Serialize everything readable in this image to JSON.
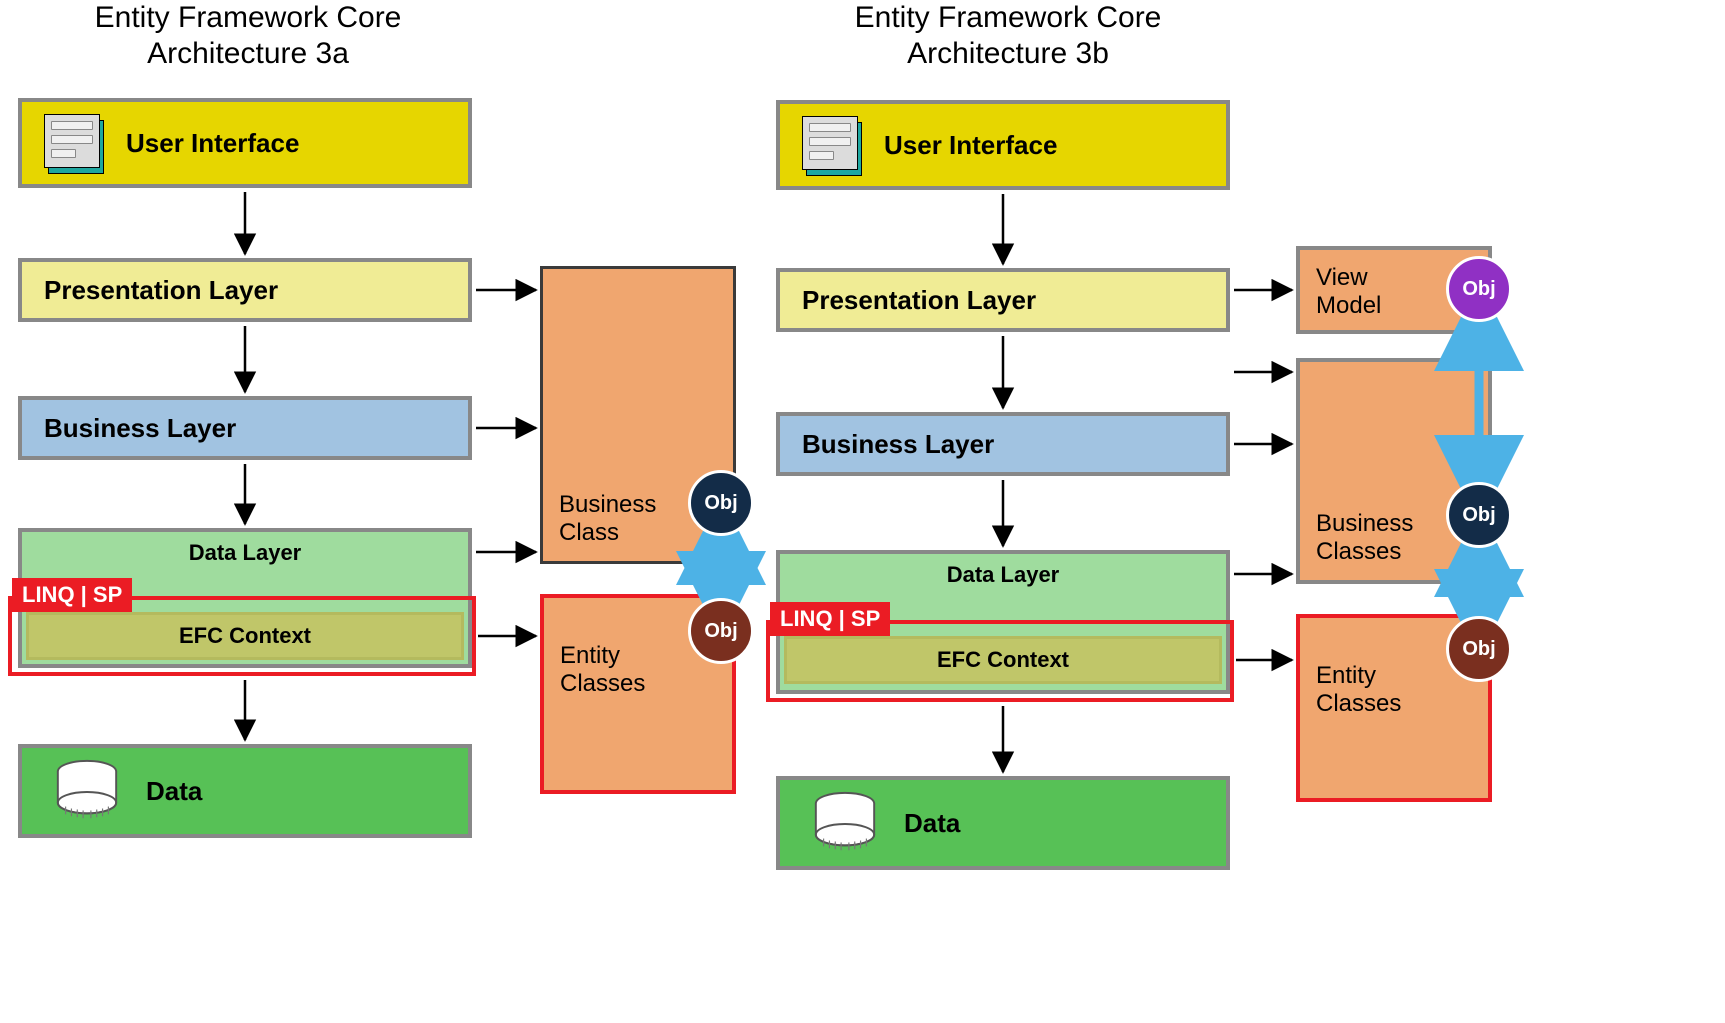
{
  "diagrams": {
    "a": {
      "title": "Entity Framework Core\nArchitecture 3a",
      "layers": {
        "ui": "User Interface",
        "presentation": "Presentation Layer",
        "business": "Business Layer",
        "data": "Data Layer",
        "linq_sp": "LINQ | SP",
        "context": "EFC Context",
        "db": "Data"
      },
      "side": {
        "business_class": "Business\nClass",
        "entity_classes": "Entity\nClasses"
      },
      "obj": {
        "biz": "Obj",
        "ent": "Obj"
      }
    },
    "b": {
      "title": "Entity Framework Core\nArchitecture 3b",
      "layers": {
        "ui": "User Interface",
        "presentation": "Presentation Layer",
        "business": "Business Layer",
        "data": "Data Layer",
        "linq_sp": "LINQ | SP",
        "context": "EFC Context",
        "db": "Data"
      },
      "side": {
        "view_model": "View\nModel",
        "business_classes": "Business\nClasses",
        "entity_classes": "Entity\nClasses"
      },
      "obj": {
        "vm": "Obj",
        "biz": "Obj",
        "ent": "Obj"
      }
    }
  }
}
